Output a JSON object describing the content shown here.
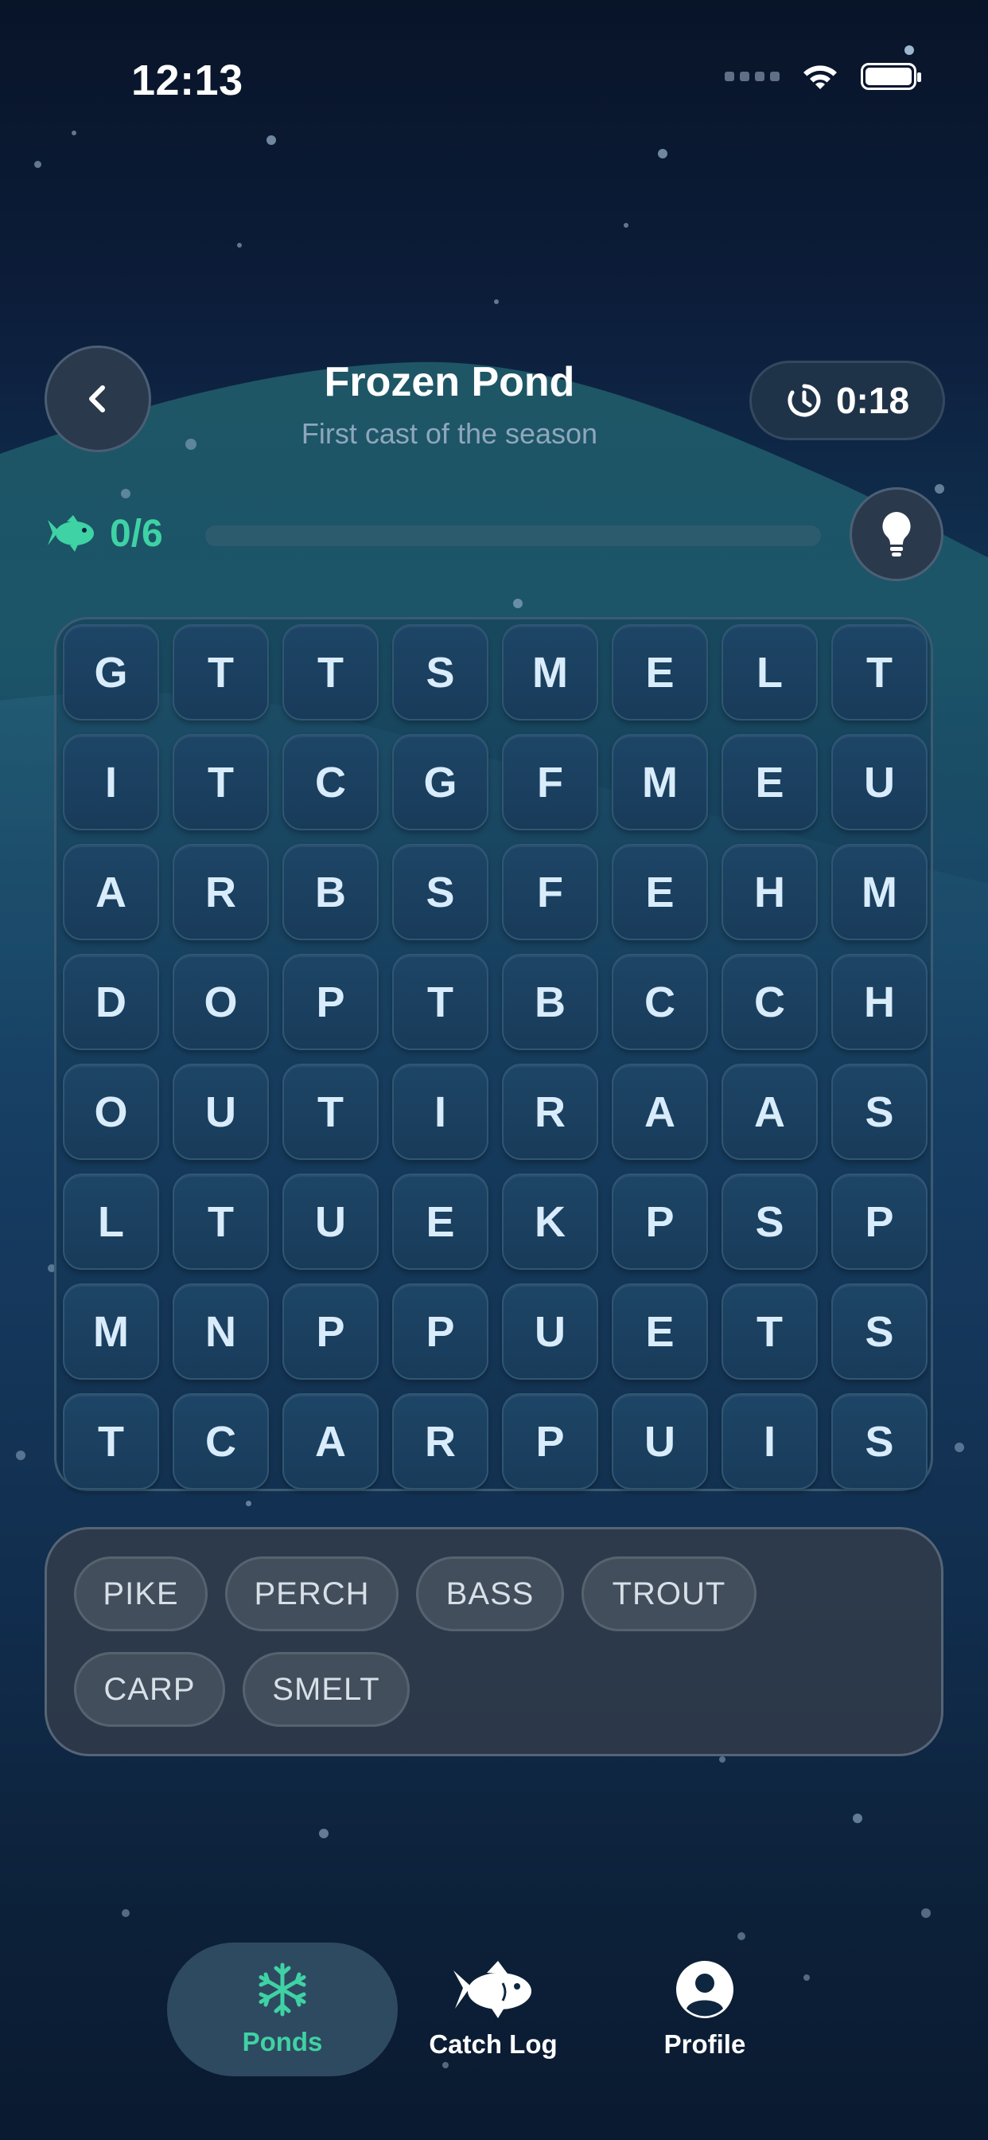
{
  "status_bar": {
    "time": "12:13"
  },
  "header": {
    "title": "Frozen Pond",
    "subtitle": "First cast of the season",
    "timer": "0:18"
  },
  "progress": {
    "found": 0,
    "total": 6,
    "label": "0/6",
    "fraction": 0.0
  },
  "grid": [
    [
      "G",
      "T",
      "T",
      "S",
      "M",
      "E",
      "L",
      "T"
    ],
    [
      "I",
      "T",
      "C",
      "G",
      "F",
      "M",
      "E",
      "U"
    ],
    [
      "A",
      "R",
      "B",
      "S",
      "F",
      "E",
      "H",
      "M"
    ],
    [
      "D",
      "O",
      "P",
      "T",
      "B",
      "C",
      "C",
      "H"
    ],
    [
      "O",
      "U",
      "T",
      "I",
      "R",
      "A",
      "A",
      "S"
    ],
    [
      "L",
      "T",
      "U",
      "E",
      "K",
      "P",
      "S",
      "P"
    ],
    [
      "M",
      "N",
      "P",
      "P",
      "U",
      "E",
      "T",
      "S"
    ],
    [
      "T",
      "C",
      "A",
      "R",
      "P",
      "U",
      "I",
      "S"
    ]
  ],
  "words": [
    "PIKE",
    "PERCH",
    "BASS",
    "TROUT",
    "CARP",
    "SMELT"
  ],
  "tabbar": {
    "items": [
      {
        "label": "Ponds",
        "icon": "snowflake-icon",
        "active": true
      },
      {
        "label": "Catch Log",
        "icon": "fish-icon",
        "active": false
      },
      {
        "label": "Profile",
        "icon": "profile-icon",
        "active": false
      }
    ]
  },
  "colors": {
    "accent": "#3fd2a4",
    "tile_text": "#d9ecfb",
    "chip_text": "#d7dfe7"
  }
}
